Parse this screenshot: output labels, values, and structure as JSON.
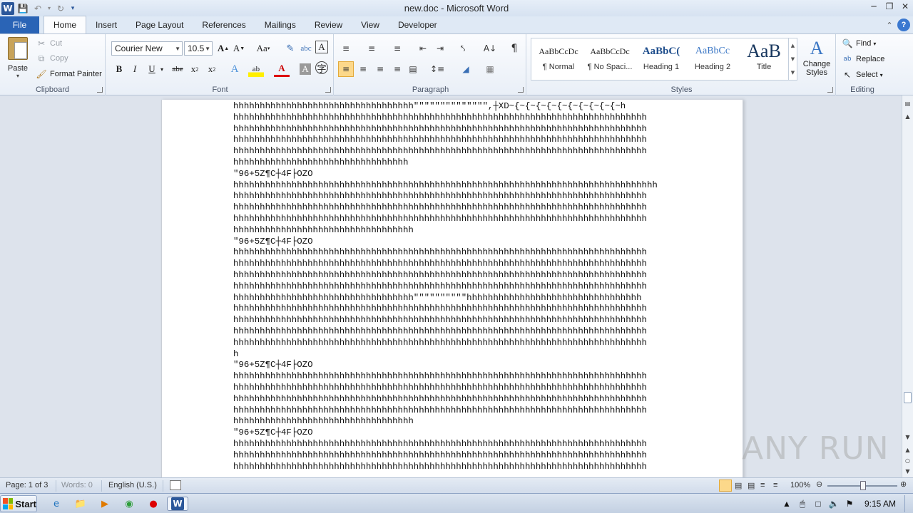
{
  "window": {
    "title": "new.doc - Microsoft Word"
  },
  "tabs": [
    {
      "label": "File"
    },
    {
      "label": "Home"
    },
    {
      "label": "Insert"
    },
    {
      "label": "Page Layout"
    },
    {
      "label": "References"
    },
    {
      "label": "Mailings"
    },
    {
      "label": "Review"
    },
    {
      "label": "View"
    },
    {
      "label": "Developer"
    }
  ],
  "clipboard": {
    "paste_label": "Paste",
    "cut_label": "Cut",
    "copy_label": "Copy",
    "format_painter_label": "Format Painter",
    "group_label": "Clipboard"
  },
  "font": {
    "font_name": "Courier New",
    "font_size": "10.5",
    "group_label": "Font"
  },
  "paragraph": {
    "group_label": "Paragraph"
  },
  "styles": {
    "items": [
      {
        "sample": "AaBbCcDc",
        "name": "¶ Normal"
      },
      {
        "sample": "AaBbCcDc",
        "name": "¶ No Spaci..."
      },
      {
        "sample": "AaBbC(",
        "name": "Heading 1"
      },
      {
        "sample": "AaBbCc",
        "name": "Heading 2"
      },
      {
        "sample": "AaB",
        "name": "Title"
      }
    ],
    "change_styles_label": "Change Styles",
    "group_label": "Styles"
  },
  "editing": {
    "find_label": "Find",
    "replace_label": "Replace",
    "select_label": "Select",
    "group_label": "Editing"
  },
  "document": {
    "lines": [
      "hhhhhhhhhhhhhhhhhhhhhhhhhhhhhhhhhh\"\"\"\"\"\"\"\"\"\"\"\"\"\",┼XD~{~{~{~{~{~{~{~{~{~{~h",
      "hhhhhhhhhhhhhhhhhhhhhhhhhhhhhhhhhhhhhhhhhhhhhhhhhhhhhhhhhhhhhhhhhhhhhhhhhhhhhh",
      "hhhhhhhhhhhhhhhhhhhhhhhhhhhhhhhhhhhhhhhhhhhhhhhhhhhhhhhhhhhhhhhhhhhhhhhhhhhhhh",
      "hhhhhhhhhhhhhhhhhhhhhhhhhhhhhhhhhhhhhhhhhhhhhhhhhhhhhhhhhhhhhhhhhhhhhhhhhhhhhh",
      "hhhhhhhhhhhhhhhhhhhhhhhhhhhhhhhhhhhhhhhhhhhhhhhhhhhhhhhhhhhhhhhhhhhhhhhhhhhhhh",
      "hhhhhhhhhhhhhhhhhhhhhhhhhhhhhhhhh",
      "\"96+5Z¶C┼4F├OZO",
      "hhhhhhhhhhhhhhhhhhhhhhhhhhhhhhhhhhhhhhhhhhhhhhhhhhhhhhhhhhhhhhhhhhhhhhhhhhhhhhhh",
      "hhhhhhhhhhhhhhhhhhhhhhhhhhhhhhhhhhhhhhhhhhhhhhhhhhhhhhhhhhhhhhhhhhhhhhhhhhhhhh",
      "hhhhhhhhhhhhhhhhhhhhhhhhhhhhhhhhhhhhhhhhhhhhhhhhhhhhhhhhhhhhhhhhhhhhhhhhhhhhhh",
      "hhhhhhhhhhhhhhhhhhhhhhhhhhhhhhhhhhhhhhhhhhhhhhhhhhhhhhhhhhhhhhhhhhhhhhhhhhhhhh",
      "hhhhhhhhhhhhhhhhhhhhhhhhhhhhhhhhhh",
      "\"96+5Z¶C┼4F├OZO",
      "hhhhhhhhhhhhhhhhhhhhhhhhhhhhhhhhhhhhhhhhhhhhhhhhhhhhhhhhhhhhhhhhhhhhhhhhhhhhhh",
      "hhhhhhhhhhhhhhhhhhhhhhhhhhhhhhhhhhhhhhhhhhhhhhhhhhhhhhhhhhhhhhhhhhhhhhhhhhhhhh",
      "hhhhhhhhhhhhhhhhhhhhhhhhhhhhhhhhhhhhhhhhhhhhhhhhhhhhhhhhhhhhhhhhhhhhhhhhhhhhhh",
      "hhhhhhhhhhhhhhhhhhhhhhhhhhhhhhhhhhhhhhhhhhhhhhhhhhhhhhhhhhhhhhhhhhhhhhhhhhhhhh",
      "hhhhhhhhhhhhhhhhhhhhhhhhhhhhhhhhhh\"\"\"\"\"\"\"\"\"\"hhhhhhhhhhhhhhhhhhhhhhhhhhhhhhhhh",
      "hhhhhhhhhhhhhhhhhhhhhhhhhhhhhhhhhhhhhhhhhhhhhhhhhhhhhhhhhhhhhhhhhhhhhhhhhhhhhh",
      "hhhhhhhhhhhhhhhhhhhhhhhhhhhhhhhhhhhhhhhhhhhhhhhhhhhhhhhhhhhhhhhhhhhhhhhhhhhhhh",
      "hhhhhhhhhhhhhhhhhhhhhhhhhhhhhhhhhhhhhhhhhhhhhhhhhhhhhhhhhhhhhhhhhhhhhhhhhhhhhh",
      "hhhhhhhhhhhhhhhhhhhhhhhhhhhhhhhhhhhhhhhhhhhhhhhhhhhhhhhhhhhhhhhhhhhhhhhhhhhhhh",
      "h",
      "\"96+5Z¶C┼4F├OZO",
      "hhhhhhhhhhhhhhhhhhhhhhhhhhhhhhhhhhhhhhhhhhhhhhhhhhhhhhhhhhhhhhhhhhhhhhhhhhhhhh",
      "hhhhhhhhhhhhhhhhhhhhhhhhhhhhhhhhhhhhhhhhhhhhhhhhhhhhhhhhhhhhhhhhhhhhhhhhhhhhhh",
      "hhhhhhhhhhhhhhhhhhhhhhhhhhhhhhhhhhhhhhhhhhhhhhhhhhhhhhhhhhhhhhhhhhhhhhhhhhhhhh",
      "hhhhhhhhhhhhhhhhhhhhhhhhhhhhhhhhhhhhhhhhhhhhhhhhhhhhhhhhhhhhhhhhhhhhhhhhhhhhhh",
      "hhhhhhhhhhhhhhhhhhhhhhhhhhhhhhhhhh",
      "\"96+5Z¶C┼4F├OZO",
      "hhhhhhhhhhhhhhhhhhhhhhhhhhhhhhhhhhhhhhhhhhhhhhhhhhhhhhhhhhhhhhhhhhhhhhhhhhhhhh",
      "hhhhhhhhhhhhhhhhhhhhhhhhhhhhhhhhhhhhhhhhhhhhhhhhhhhhhhhhhhhhhhhhhhhhhhhhhhhhhh",
      "hhhhhhhhhhhhhhhhhhhhhhhhhhhhhhhhhhhhhhhhhhhhhhhhhhhhhhhhhhhhhhhhhhhhhhhhhhhhhh"
    ]
  },
  "watermark": "ANY RUN",
  "status": {
    "page": "Page: 1 of 3",
    "words": "Words: 0",
    "language": "English (U.S.)",
    "zoom": "100%"
  },
  "taskbar": {
    "start_label": "Start",
    "clock": "9:15 AM"
  },
  "colors": {
    "file_tab": "#2a64b6",
    "accent": "#2b579a"
  }
}
